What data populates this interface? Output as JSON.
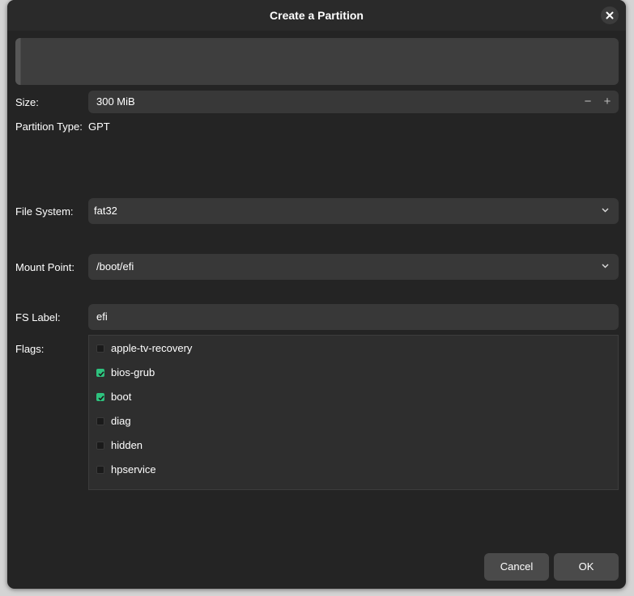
{
  "dialog": {
    "title": "Create a Partition",
    "close_icon": "close-icon"
  },
  "form": {
    "size_label": "Size:",
    "size_value": "300 MiB",
    "size_decrement": "−",
    "size_increment": "+",
    "partition_type_label": "Partition Type:",
    "partition_type_value": "GPT",
    "file_system_label": "File System:",
    "file_system_value": "fat32",
    "mount_point_label": "Mount Point:",
    "mount_point_value": "/boot/efi",
    "fs_label_label": "FS Label:",
    "fs_label_value": "efi",
    "flags_label": "Flags:"
  },
  "flags": [
    {
      "label": "apple-tv-recovery",
      "checked": false
    },
    {
      "label": "bios-grub",
      "checked": true
    },
    {
      "label": "boot",
      "checked": true
    },
    {
      "label": "diag",
      "checked": false
    },
    {
      "label": "hidden",
      "checked": false
    },
    {
      "label": "hpservice",
      "checked": false
    }
  ],
  "buttons": {
    "cancel": "Cancel",
    "ok": "OK"
  },
  "colors": {
    "accent": "#2ec27e",
    "background": "#242424",
    "field": "#383838"
  }
}
